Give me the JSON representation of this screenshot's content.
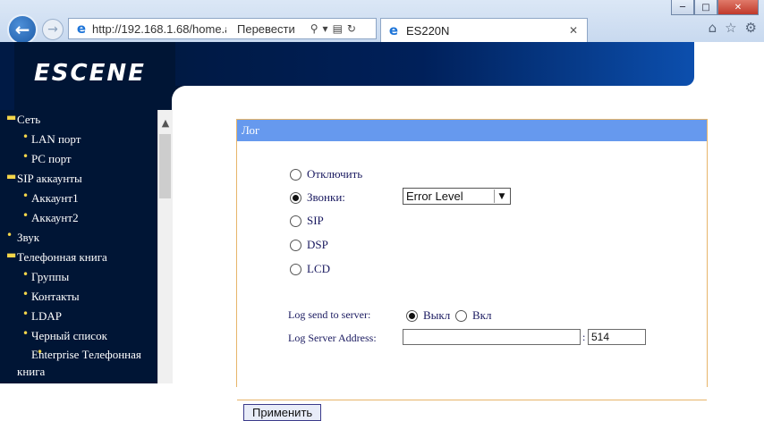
{
  "browser": {
    "url": "http://192.168.1.68/home.asp",
    "translate_label": "Перевести",
    "tab_title": "ES220N"
  },
  "brand": {
    "logo_text": "ESCENE"
  },
  "sidebar": {
    "items": [
      {
        "label": "Сеть",
        "level": 1
      },
      {
        "label": "LAN порт",
        "level": 2
      },
      {
        "label": "PC порт",
        "level": 2
      },
      {
        "label": "SIP аккаунты",
        "level": 1
      },
      {
        "label": "Аккаунт1",
        "level": 2
      },
      {
        "label": "Аккаунт2",
        "level": 2
      },
      {
        "label": "Звук",
        "level": 1
      },
      {
        "label": "Телефонная книга",
        "level": 1
      },
      {
        "label": "Группы",
        "level": 2
      },
      {
        "label": "Контакты",
        "level": 2
      },
      {
        "label": "LDAP",
        "level": 2
      },
      {
        "label": "Черный список",
        "level": 2
      },
      {
        "label": "Enterprise Телефонная книга",
        "level": 2
      }
    ]
  },
  "log_panel": {
    "title": "Лог",
    "options": [
      {
        "label": "Отключить",
        "checked": false
      },
      {
        "label": "Звонки:",
        "checked": true
      },
      {
        "label": "SIP",
        "checked": false
      },
      {
        "label": "DSP",
        "checked": false
      },
      {
        "label": "LCD",
        "checked": false
      }
    ],
    "level_select": {
      "value": "Error Level"
    },
    "send_to_server": {
      "label": "Log send to server:",
      "off_label": "Выкл",
      "on_label": "Вкл",
      "selected": "off"
    },
    "server_address": {
      "label": "Log Server Address:",
      "address_value": "",
      "port_value": "514"
    },
    "apply_label": "Применить"
  }
}
